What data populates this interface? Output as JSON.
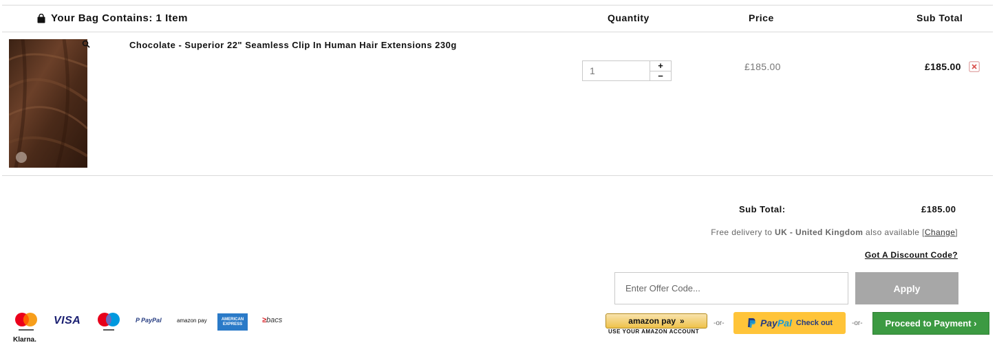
{
  "cart": {
    "title": "Your Bag Contains: 1 Item",
    "columns": {
      "quantity": "Quantity",
      "price": "Price",
      "subtotal": "Sub Total"
    },
    "item": {
      "name": "Chocolate - Superior 22\" Seamless Clip In Human Hair Extensions 230g",
      "quantity": "1",
      "qty_plus": "+",
      "qty_minus": "−",
      "unit_price": "£185.00",
      "line_total": "£185.00"
    }
  },
  "summary": {
    "subtotal_label": "Sub Total:",
    "subtotal_value": "£185.00",
    "delivery_prefix": "Free delivery to ",
    "delivery_country": "UK - United Kingdom",
    "delivery_suffix": " also available [",
    "delivery_change": "Change",
    "delivery_close": "]",
    "discount_link": "Got A Discount Code?",
    "offer_placeholder": "Enter Offer Code...",
    "apply_label": "Apply"
  },
  "checkout": {
    "amazon_label": "amazon pay",
    "amazon_chevrons": "»",
    "amazon_caption": "USE YOUR AMAZON ACCOUNT",
    "or_label": "-or-",
    "paypal_word_pay": "Pay",
    "paypal_word_pal": "Pal",
    "paypal_checkout": "Check out",
    "proceed_label": "Proceed to Payment ›"
  },
  "payment_methods": {
    "visa": "VISA",
    "paypal_pay": "P PayPal",
    "amazonpay": "amazon pay",
    "amex_line1": "AMERICAN",
    "amex_line2": "EXPRESS",
    "bacs_mark": "≥",
    "bacs": "bacs",
    "klarna": "Klarna."
  },
  "colors": {
    "accent_green": "#3c9a42",
    "paypal_yellow": "#ffc439",
    "apply_grey": "#a7a7a7",
    "remove_red": "#d9534f"
  }
}
